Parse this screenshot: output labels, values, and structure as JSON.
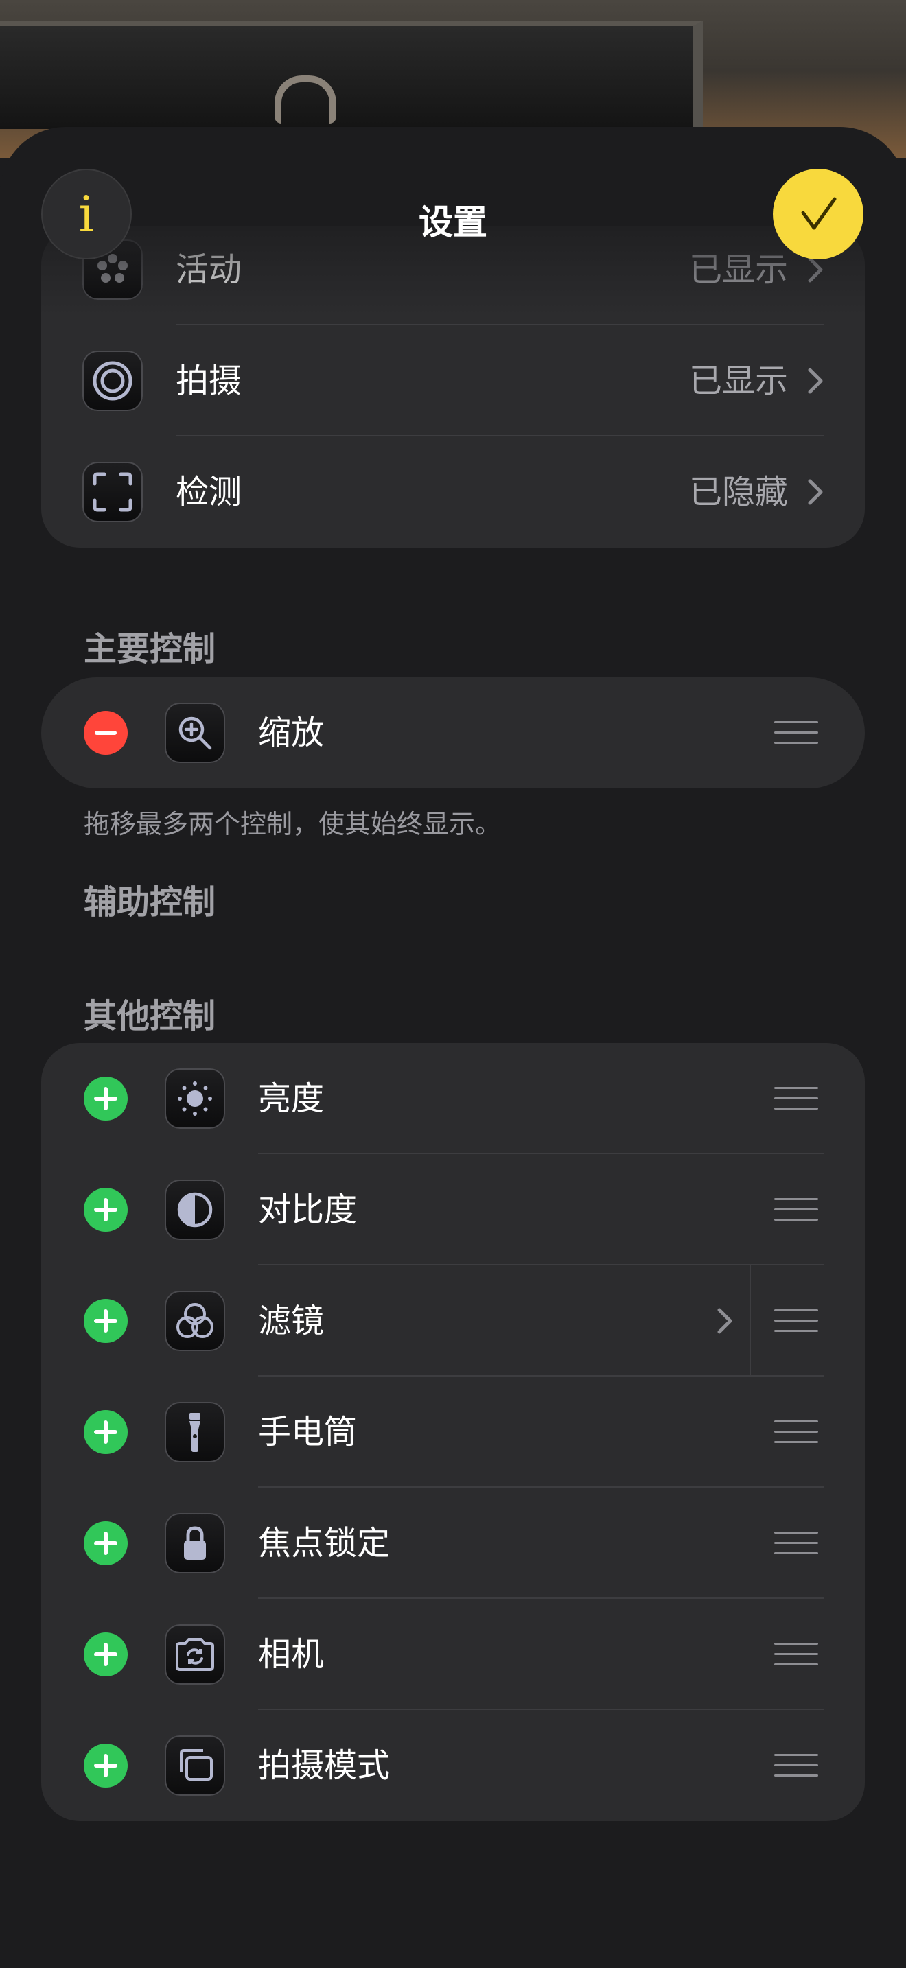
{
  "header": {
    "title": "设置",
    "info_label": "i"
  },
  "visibility_list": [
    {
      "label": "活动",
      "value": "已显示",
      "icon": "activity-dots-icon"
    },
    {
      "label": "拍摄",
      "value": "已显示",
      "icon": "capture-target-icon"
    },
    {
      "label": "检测",
      "value": "已隐藏",
      "icon": "detection-frame-icon"
    }
  ],
  "primary": {
    "header": "主要控制",
    "items": [
      {
        "label": "缩放",
        "icon": "magnifier-zoom-icon"
      }
    ],
    "footnote": "拖移最多两个控制，使其始终显示。"
  },
  "secondary": {
    "header": "辅助控制"
  },
  "other": {
    "header": "其他控制",
    "items": [
      {
        "label": "亮度",
        "icon": "sun-brightness-icon"
      },
      {
        "label": "对比度",
        "icon": "contrast-circle-icon"
      },
      {
        "label": "滤镜",
        "icon": "filter-circles-icon"
      },
      {
        "label": "手电筒",
        "icon": "flashlight-icon"
      },
      {
        "label": "焦点锁定",
        "icon": "lock-icon"
      },
      {
        "label": "相机",
        "icon": "camera-switch-icon"
      },
      {
        "label": "拍摄模式",
        "icon": "capture-mode-icon"
      }
    ]
  },
  "colors": {
    "accent": "#f8d93d",
    "add": "#31c759",
    "remove": "#ff453a",
    "card": "#2c2c2e",
    "background": "#1c1c1e"
  }
}
